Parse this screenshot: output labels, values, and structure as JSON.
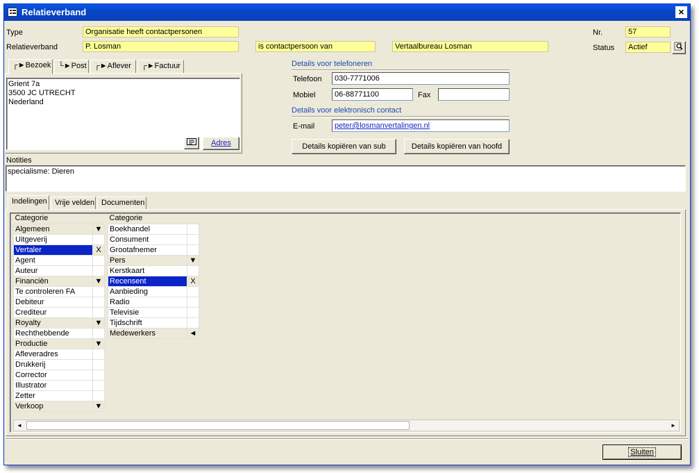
{
  "window": {
    "title": "Relatieverband",
    "close_label": "×"
  },
  "header": {
    "type_label": "Type",
    "type_value": "Organisatie heeft contactpersonen",
    "relatie_label": "Relatieverband",
    "relatie_value": "P. Losman",
    "relation_value": "is contactpersoon van",
    "target_value": "Vertaalbureau Losman",
    "nr_label": "Nr.",
    "nr_value": "57",
    "status_label": "Status",
    "status_value": "Actief"
  },
  "address_tabs": [
    {
      "label": "┌►Bezoek"
    },
    {
      "label": "└►Post"
    },
    {
      "label": "┌►Aflever"
    },
    {
      "label": "┌►Factuur"
    }
  ],
  "address": {
    "lines": [
      "Grient 7a",
      "3500 JC  UTRECHT",
      "Nederland"
    ],
    "adres_button": "Adres"
  },
  "phone": {
    "heading": "Details voor telefoneren",
    "telefoon_label": "Telefoon",
    "telefoon_value": "030-7771006",
    "mobiel_label": "Mobiel",
    "mobiel_value": "06-88771100",
    "fax_label": "Fax",
    "fax_value": ""
  },
  "electronic": {
    "heading": "Details voor elektronisch contact",
    "email_label": "E-mail",
    "email_value": "peter@losmanvertalingen.nl"
  },
  "buttons": {
    "copy_sub": "Details kopiëren van sub",
    "copy_main": "Details kopiëren van hoofd",
    "close": "Sluiten"
  },
  "notes": {
    "label": "Notities",
    "value": "specialisme: Dieren"
  },
  "bottom_tabs": [
    {
      "label": "Indelingen"
    },
    {
      "label": "Vrije velden"
    },
    {
      "label": "Documenten"
    }
  ],
  "categories_left": {
    "caption": "Categorie",
    "rows": [
      {
        "label": "Algemeen",
        "kind": "header",
        "mark": "▼"
      },
      {
        "label": "Uitgeverij",
        "kind": "plain",
        "mark": ""
      },
      {
        "label": "Vertaler",
        "kind": "sel",
        "mark": "X"
      },
      {
        "label": "Agent",
        "kind": "plain",
        "mark": ""
      },
      {
        "label": "Auteur",
        "kind": "plain",
        "mark": ""
      },
      {
        "label": "Financiën",
        "kind": "header",
        "mark": "▼"
      },
      {
        "label": "Te controleren FA",
        "kind": "plain",
        "mark": ""
      },
      {
        "label": "Debiteur",
        "kind": "plain",
        "mark": ""
      },
      {
        "label": "Crediteur",
        "kind": "plain",
        "mark": ""
      },
      {
        "label": "Royalty",
        "kind": "header",
        "mark": "▼"
      },
      {
        "label": "Rechthebbende",
        "kind": "plain",
        "mark": ""
      },
      {
        "label": "Productie",
        "kind": "header",
        "mark": "▼"
      },
      {
        "label": "Afleveradres",
        "kind": "plain",
        "mark": ""
      },
      {
        "label": "Drukkerij",
        "kind": "plain",
        "mark": ""
      },
      {
        "label": "Corrector",
        "kind": "plain",
        "mark": ""
      },
      {
        "label": "Illustrator",
        "kind": "plain",
        "mark": ""
      },
      {
        "label": "Zetter",
        "kind": "plain",
        "mark": ""
      },
      {
        "label": "Verkoop",
        "kind": "header",
        "mark": "▼"
      }
    ]
  },
  "categories_right": {
    "caption": "Categorie",
    "rows": [
      {
        "label": "Boekhandel",
        "kind": "plain",
        "mark": ""
      },
      {
        "label": "Consument",
        "kind": "plain",
        "mark": ""
      },
      {
        "label": "Grootafnemer",
        "kind": "plain",
        "mark": ""
      },
      {
        "label": "Pers",
        "kind": "header",
        "mark": "▼"
      },
      {
        "label": "Kerstkaart",
        "kind": "plain",
        "mark": ""
      },
      {
        "label": "Recensent",
        "kind": "sel",
        "mark": "X"
      },
      {
        "label": "Aanbieding",
        "kind": "plain",
        "mark": ""
      },
      {
        "label": "Radio",
        "kind": "plain",
        "mark": ""
      },
      {
        "label": "Televisie",
        "kind": "plain",
        "mark": ""
      },
      {
        "label": "Tijdschrift",
        "kind": "plain",
        "mark": ""
      },
      {
        "label": "Medewerkers",
        "kind": "header",
        "mark": "◄"
      }
    ]
  },
  "scrollbar": {
    "left_arrow": "◄",
    "right_arrow": "►"
  },
  "colors": {
    "field_yellow": "#ffff99",
    "title_blue": "#0846c8",
    "selection_blue": "#0a24c8",
    "heading_blue": "#1c4bb6"
  }
}
